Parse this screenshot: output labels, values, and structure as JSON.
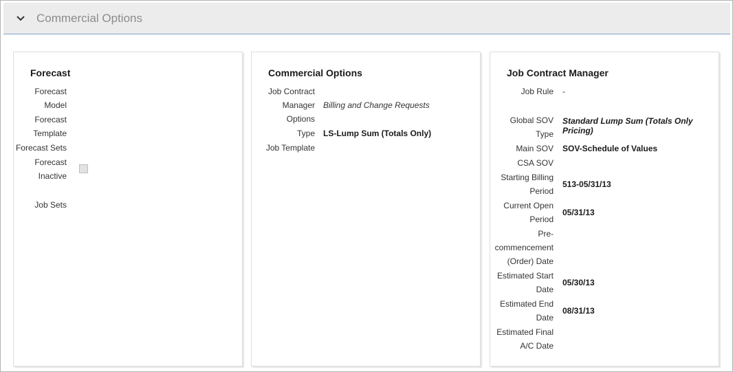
{
  "section": {
    "title": "Commercial Options"
  },
  "forecast": {
    "title": "Forecast",
    "model_label_1": "Forecast",
    "model_label_2": "Model",
    "template_label_1": "Forecast",
    "template_label_2": "Template",
    "sets_label": "Forecast Sets",
    "inactive_label_1": "Forecast",
    "inactive_label_2": "Inactive",
    "job_sets_label": "Job Sets"
  },
  "commercial": {
    "title": "Commercial Options",
    "jcm_options_label_1": "Job Contract",
    "jcm_options_label_2": "Manager",
    "jcm_options_label_3": "Options",
    "jcm_options_value": "Billing and Change Requests",
    "type_label": "Type",
    "type_value": "LS-Lump Sum (Totals Only)",
    "job_template_label": "Job Template"
  },
  "jcm": {
    "title": "Job Contract Manager",
    "job_rule_label": "Job Rule",
    "job_rule_value": "-",
    "global_sov_label_1": "Global SOV",
    "global_sov_label_2": "Type",
    "global_sov_value_1": "Standard Lump Sum (Totals Only",
    "global_sov_value_2": "Pricing)",
    "main_sov_label": "Main SOV",
    "main_sov_value": "SOV-Schedule of Values",
    "csa_sov_label": "CSA SOV",
    "start_billing_label_1": "Starting Billing",
    "start_billing_label_2": "Period",
    "start_billing_value": "513-05/31/13",
    "current_open_label_1": "Current Open",
    "current_open_label_2": "Period",
    "current_open_value": "05/31/13",
    "precomm_label_1": "Pre-",
    "precomm_label_2": "commencement",
    "precomm_label_3": "(Order) Date",
    "est_start_label_1": "Estimated Start",
    "est_start_label_2": "Date",
    "est_start_value": "05/30/13",
    "est_end_label_1": "Estimated End",
    "est_end_label_2": "Date",
    "est_end_value": "08/31/13",
    "est_final_label_1": "Estimated Final",
    "est_final_label_2": "A/C Date"
  }
}
